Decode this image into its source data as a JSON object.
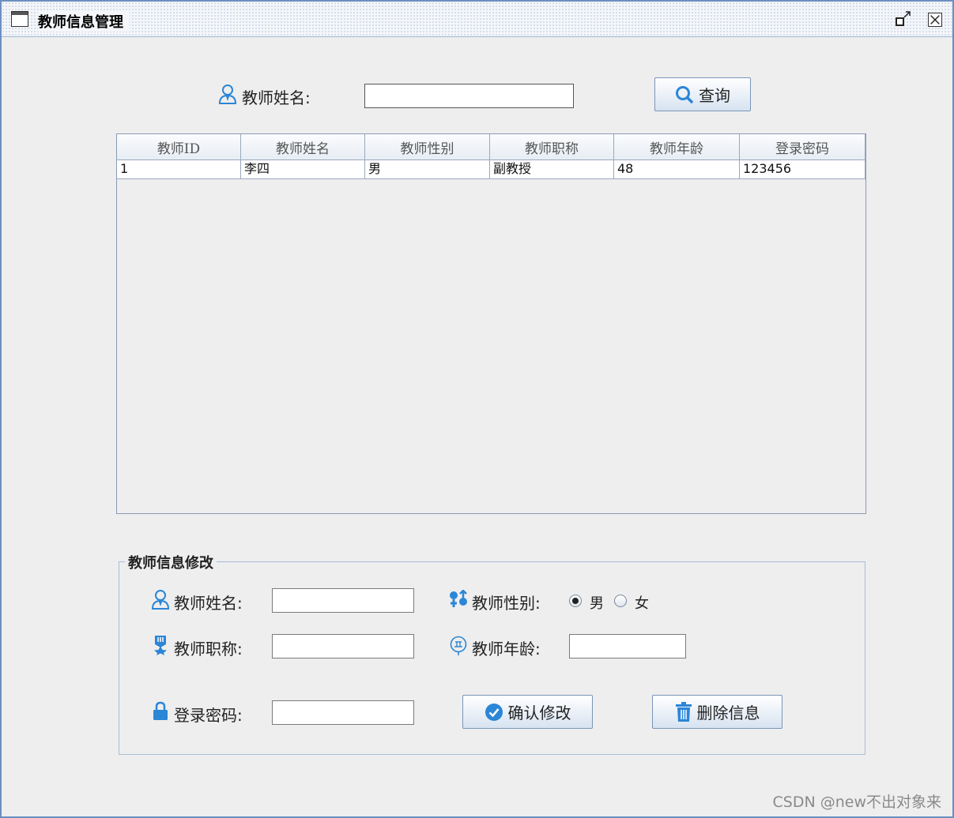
{
  "window": {
    "title": "教师信息管理"
  },
  "search": {
    "label": "教师姓名:",
    "value": "",
    "button_label": "查询"
  },
  "table": {
    "columns": [
      "教师ID",
      "教师姓名",
      "教师性别",
      "教师职称",
      "教师年龄",
      "登录密码"
    ],
    "rows": [
      [
        "1",
        "李四",
        "男",
        "副教授",
        "48",
        "123456"
      ]
    ]
  },
  "edit_form": {
    "group_title": "教师信息修改",
    "name_label": "教师姓名:",
    "name_value": "",
    "gender_label": "教师性别:",
    "gender_options": [
      "男",
      "女"
    ],
    "gender_selected": "男",
    "title_label": "教师职称:",
    "title_value": "",
    "age_label": "教师年龄:",
    "age_value": "",
    "password_label": "登录密码:",
    "password_value": "",
    "confirm_button": "确认修改",
    "delete_button": "删除信息"
  },
  "watermark": "CSDN @new不出对象来",
  "colors": {
    "accent": "#2b86d6",
    "border": "#6b8fbf"
  }
}
